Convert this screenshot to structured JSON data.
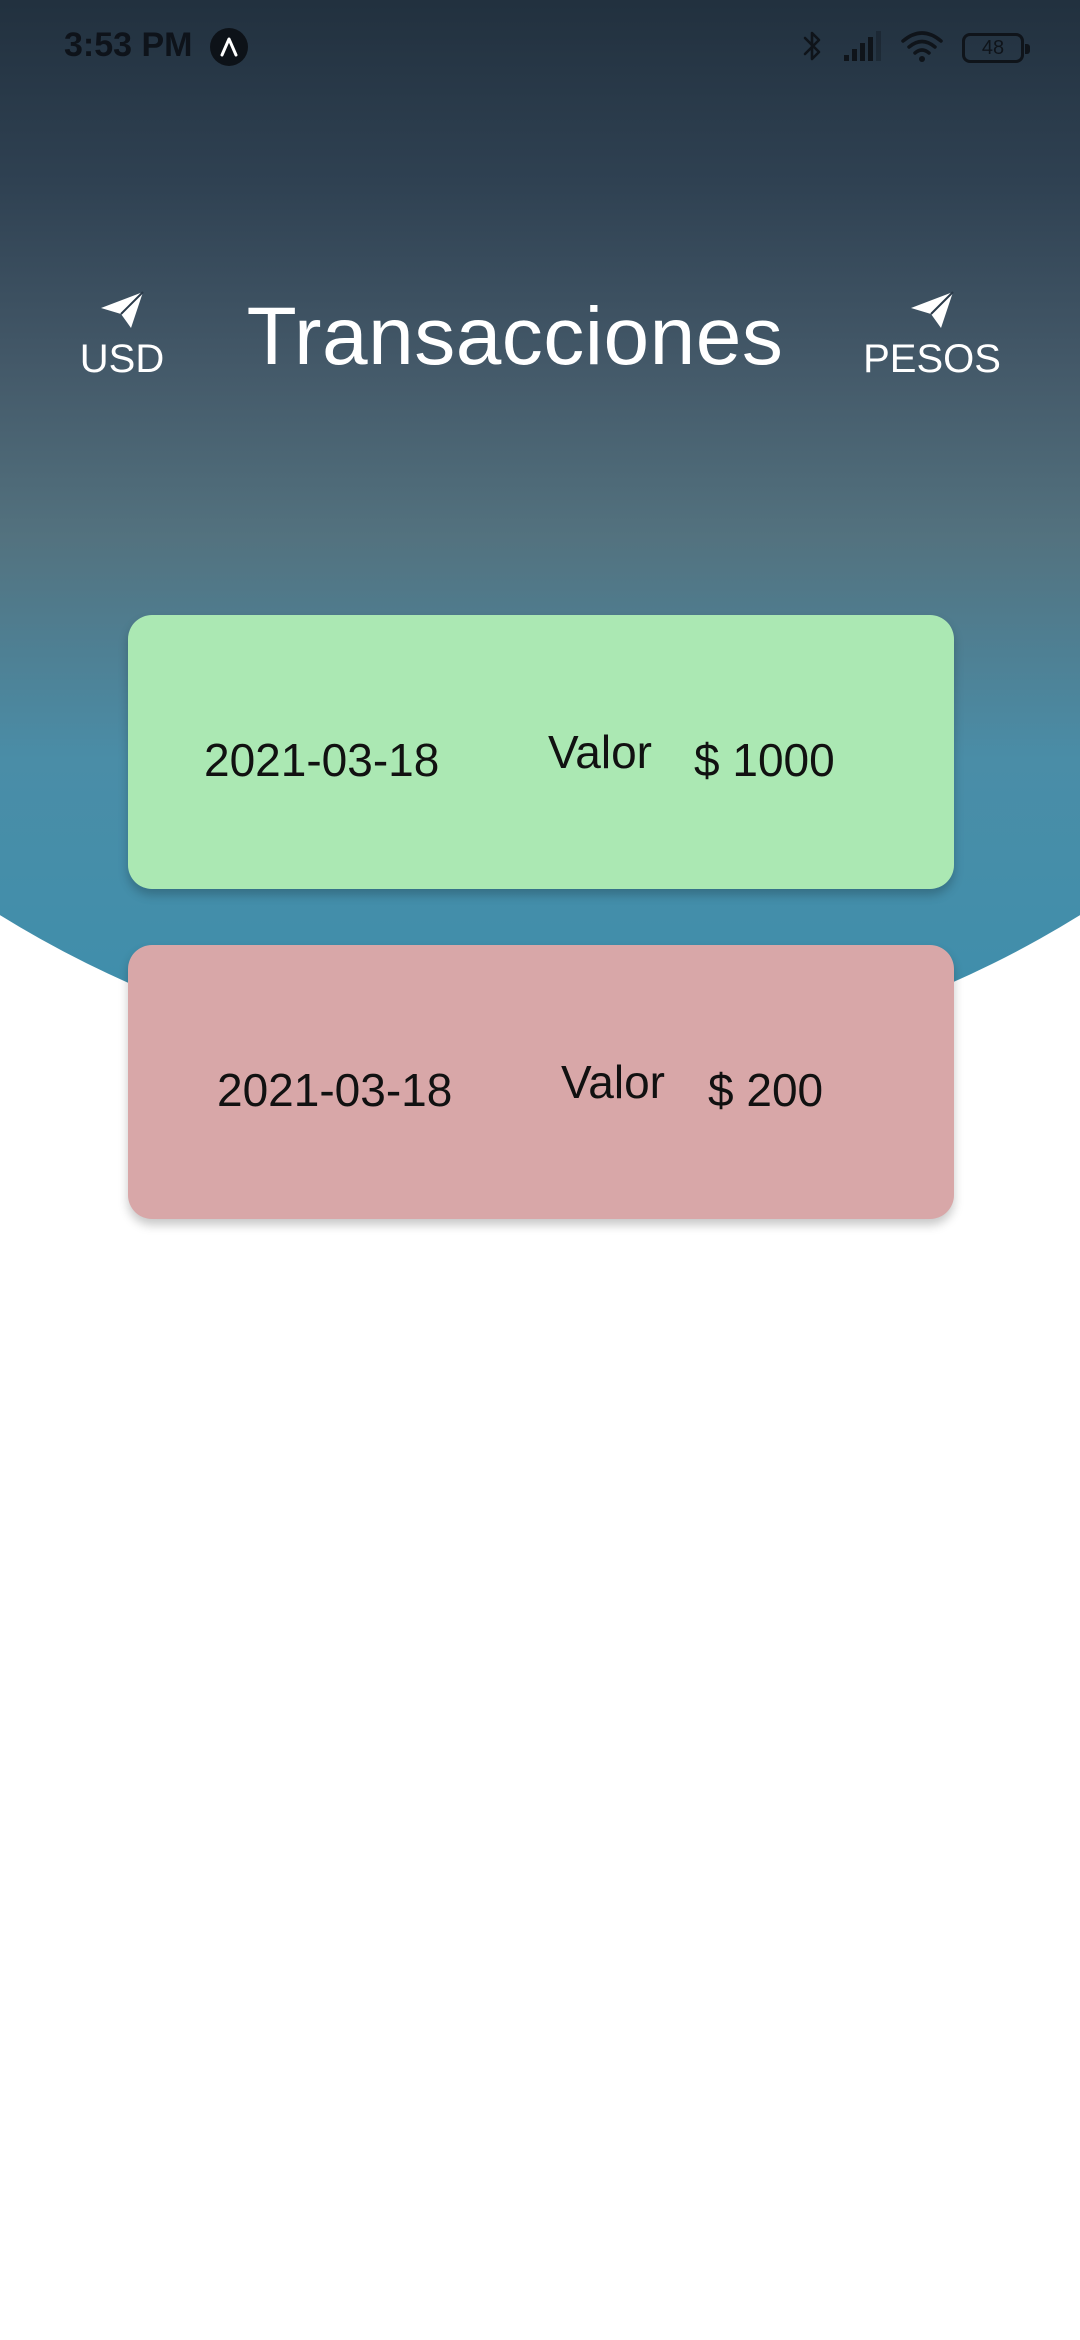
{
  "status_bar": {
    "time": "3:53 PM",
    "battery": "48",
    "icons": [
      "app-notification-icon",
      "bluetooth-icon",
      "signal-icon",
      "wifi-icon",
      "battery-icon"
    ]
  },
  "header": {
    "title": "Transacciones",
    "left_button": {
      "label": "USD",
      "icon": "send-icon"
    },
    "right_button": {
      "label": "PESOS",
      "icon": "send-icon"
    }
  },
  "transactions": [
    {
      "date": "2021-03-18",
      "value_label": "Valor",
      "amount": "$ 1000",
      "color": "#abe8b3"
    },
    {
      "date": "2021-03-18",
      "value_label": "Valor",
      "amount": "$ 200",
      "color": "#d8a7a8"
    }
  ],
  "colors": {
    "header_dark": "#22313f",
    "header_light": "#3c8fad",
    "income": "#abe8b3",
    "expense": "#d8a7a8"
  }
}
